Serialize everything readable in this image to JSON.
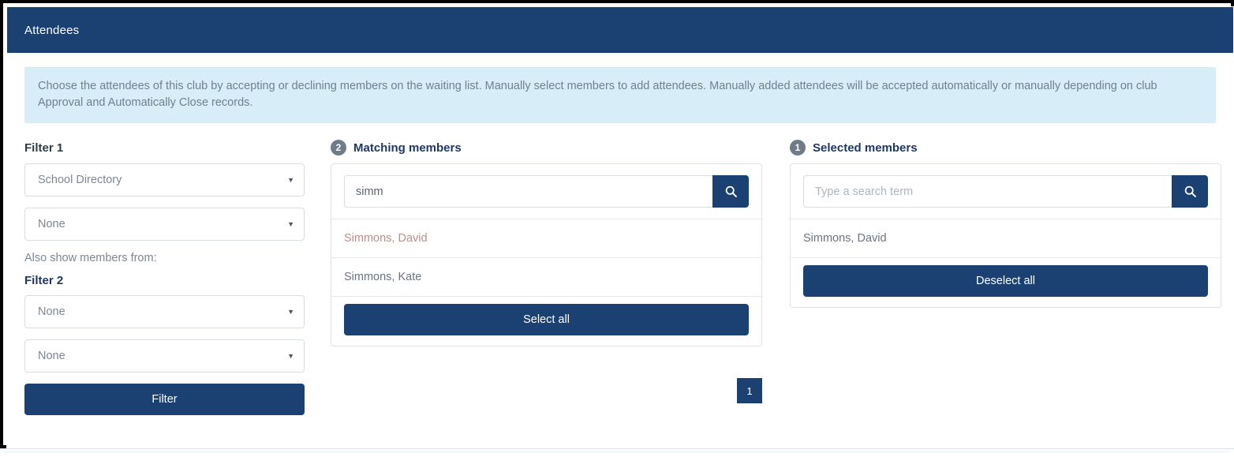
{
  "window": {
    "title": "Attendees"
  },
  "info_banner": {
    "text": "Choose the attendees of this club by accepting or declining members on the waiting list. Manually select members to add attendees. Manually added attendees will be accepted automatically or manually depending on club Approval and Automatically Close records."
  },
  "filters": {
    "filter1_label": "Filter 1",
    "filter1_primary": {
      "value": "School Directory",
      "caret": "▼"
    },
    "filter1_secondary": {
      "value": "None",
      "caret": "▼"
    },
    "also_show_label": "Also show members from:",
    "filter2_label": "Filter 2",
    "filter2_primary": {
      "value": "None",
      "caret": "▼"
    },
    "filter2_secondary": {
      "value": "None",
      "caret": "▼"
    },
    "filter_button": "Filter"
  },
  "matching": {
    "step": "2",
    "heading": "Matching members",
    "search": {
      "value": "simm",
      "placeholder": "Type a search term",
      "icon": "search-icon"
    },
    "rows": [
      {
        "name": "Simmons, David",
        "state": "taken"
      },
      {
        "name": "Simmons, Kate",
        "state": "available"
      }
    ],
    "select_all_button": "Select all",
    "pagination": {
      "current_page": "1"
    }
  },
  "selected": {
    "step": "1",
    "heading": "Selected members",
    "search": {
      "value": "",
      "placeholder": "Type a search term",
      "icon": "search-icon"
    },
    "rows": [
      {
        "name": "Simmons, David"
      }
    ],
    "deselect_all_button": "Deselect all"
  },
  "colors": {
    "navy": "#1a4172",
    "banner_bg": "#d7edf7",
    "badge_gray": "#6e7c8a",
    "taken_text": "#bb8d89"
  }
}
